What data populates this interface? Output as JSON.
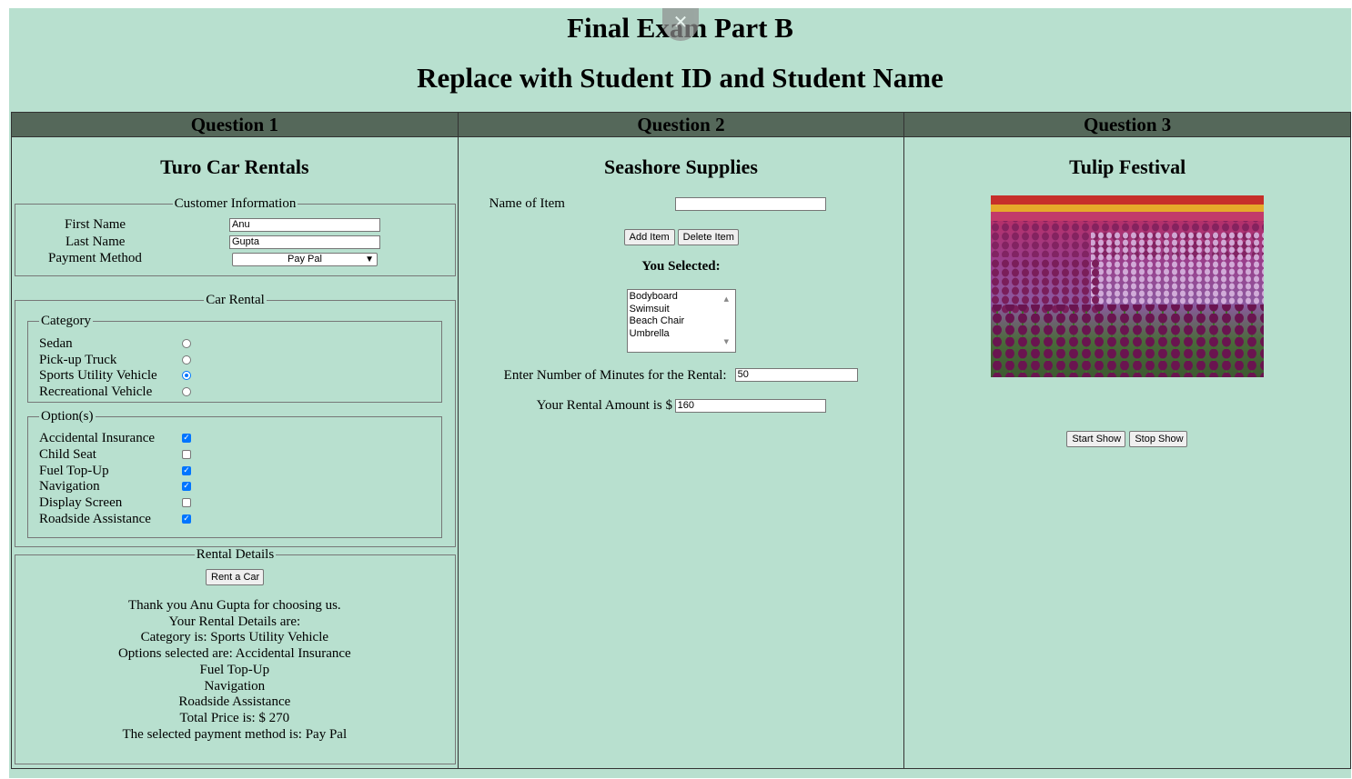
{
  "header": {
    "title": "Final Exam Part B",
    "subtitle": "Replace with Student ID and Student Name",
    "close_glyph": "✕"
  },
  "columns": [
    "Question 1",
    "Question 2",
    "Question 3"
  ],
  "q1": {
    "heading": "Turo Car Rentals",
    "customer_legend": "Customer Information",
    "first_name_label": "First Name",
    "first_name_value": "Anu",
    "last_name_label": "Last Name",
    "last_name_value": "Gupta",
    "payment_label": "Payment Method",
    "payment_value": "Pay Pal",
    "car_rental_legend": "Car Rental",
    "category_legend": "Category",
    "categories": [
      {
        "label": "Sedan",
        "checked": false
      },
      {
        "label": "Pick-up Truck",
        "checked": false
      },
      {
        "label": "Sports Utility Vehicle",
        "checked": true
      },
      {
        "label": "Recreational Vehicle",
        "checked": false
      }
    ],
    "options_legend": "Option(s)",
    "options": [
      {
        "label": "Accidental Insurance",
        "checked": true
      },
      {
        "label": "Child Seat",
        "checked": false
      },
      {
        "label": "Fuel Top-Up",
        "checked": true
      },
      {
        "label": "Navigation",
        "checked": true
      },
      {
        "label": "Display Screen",
        "checked": false
      },
      {
        "label": "Roadside Assistance",
        "checked": true
      }
    ],
    "details_legend": "Rental Details",
    "rent_button": "Rent a Car",
    "summary_lines": [
      "Thank you Anu Gupta for choosing us.",
      "Your Rental Details are:",
      "Category is: Sports Utility Vehicle",
      "Options selected are: Accidental Insurance",
      "Fuel Top-Up",
      "Navigation",
      "Roadside Assistance",
      "Total Price is: $ 270",
      "The selected payment method is: Pay Pal"
    ]
  },
  "q2": {
    "heading": "Seashore Supplies",
    "item_label": "Name of Item",
    "item_value": "",
    "add_button": "Add Item",
    "delete_button": "Delete Item",
    "selected_label": "You Selected:",
    "items": [
      "Bodyboard",
      "Swimsuit",
      "Beach Chair",
      "Umbrella"
    ],
    "minutes_label": "Enter Number of Minutes for the Rental:",
    "minutes_value": "50",
    "amount_label": "Your Rental Amount is $",
    "amount_value": "160"
  },
  "q3": {
    "heading": "Tulip Festival",
    "start_button": "Start Show",
    "stop_button": "Stop Show"
  }
}
